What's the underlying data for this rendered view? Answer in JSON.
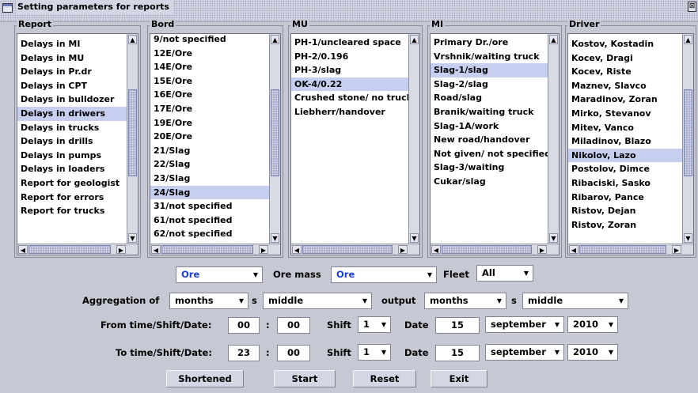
{
  "window": {
    "title": "Setting parameters for reports",
    "close": "⊠"
  },
  "lists": [
    {
      "legend": "Report",
      "items": [
        "Delays in MI",
        "Delays in MU",
        "Delays in Pr.dr",
        "Delays in CPT",
        "Delays in bulldozer",
        "Delays in driwers",
        "Delays in trucks",
        "Delays in drills",
        "Delays in pumps",
        "Delays in loaders",
        "Report for geologist",
        "Report for errors",
        "Report for trucks"
      ],
      "selected": 5
    },
    {
      "legend": "Bord",
      "items": [
        "9/not specified",
        "12E/Ore",
        "14E/Ore",
        "15E/Ore",
        "16E/Ore",
        "17E/Ore",
        "19E/Ore",
        "20E/Ore",
        "21/Slag",
        "22/Slag",
        "23/Slag",
        "24/Slag",
        "31/not specified",
        "61/not specified",
        "62/not specified"
      ],
      "selected": 11
    },
    {
      "legend": "MU",
      "items": [
        "PH-1/uncleared space",
        "PH-2/0.196",
        "PH-3/slag",
        "OK-4/0.22",
        "Crushed stone/ no trucks",
        "Liebherr/handover"
      ],
      "selected": 3
    },
    {
      "legend": "MI",
      "items": [
        "Primary Dr./ore",
        "Vrshnik/waiting truck",
        "Slag-1/slag",
        "Slag-2/slag",
        "Road/slag",
        "Branik/waiting truck",
        "Slag-1A/work",
        "New road/handover",
        "Not given/ not specified",
        "Slag-3/waiting",
        "Cukar/slag"
      ],
      "selected": 2
    },
    {
      "legend": "Driver",
      "items": [
        "Kostov, Kostadin",
        "Kocev, Dragi",
        "Kocev, Riste",
        "Maznev, Slavco",
        "Maradinov, Zoran",
        "Mirko, Stevanov",
        "Mitev, Vanco",
        "Miladinov, Blazo",
        "Nikolov, Lazo",
        "Postolov, Dimce",
        "Ribaciski, Sasko",
        "Ribarov, Pance",
        "Ristov, Dejan",
        "Ristov, Zoran"
      ],
      "selected": 8
    }
  ],
  "filters": {
    "material": "Ore",
    "ore_mass_label": "Ore mass",
    "ore_mass": "Ore",
    "fleet_label": "Fleet",
    "fleet": "All"
  },
  "aggregation": {
    "label": "Aggregation of",
    "agg_period": "months",
    "sep1": "s",
    "agg_mode": "middle",
    "output_label": "output",
    "out_period": "months",
    "sep2": "s",
    "out_mode": "middle"
  },
  "from": {
    "label": "From time/Shift/Date:",
    "hour": "00",
    "colon": ":",
    "minute": "00",
    "shift_label": "Shift",
    "shift": "1",
    "date_label": "Date",
    "day": "15",
    "month": "september",
    "year": "2010"
  },
  "to": {
    "label": "To time/Shift/Date:",
    "hour": "23",
    "colon": ":",
    "minute": "00",
    "shift_label": "Shift",
    "shift": "1",
    "date_label": "Date",
    "day": "15",
    "month": "september",
    "year": "2010"
  },
  "buttons": {
    "shortened": "Shortened",
    "start": "Start",
    "reset": "Reset",
    "exit": "Exit"
  }
}
